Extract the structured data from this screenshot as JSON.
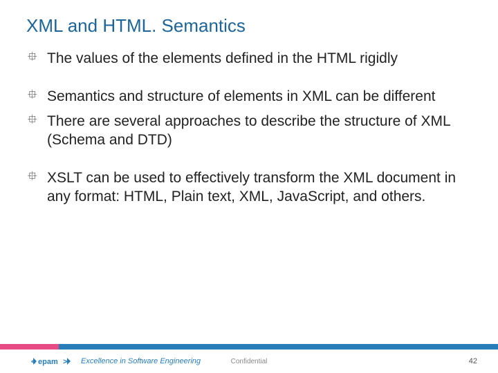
{
  "title": "XML and HTML. Semantics",
  "bullets": [
    "The values of the elements defined in the HTML rigidly",
    "Semantics and structure of elements in XML can be different",
    "There are several approaches to describe the structure of XML (Schema and DTD)",
    "XSLT can be used to effectively transform the XML document in any format: HTML, Plain text, XML, JavaScript, and others."
  ],
  "footer": {
    "brand": "<epam>",
    "tagline": "Excellence in Software Engineering",
    "confidential": "Confidential",
    "page": "42"
  }
}
